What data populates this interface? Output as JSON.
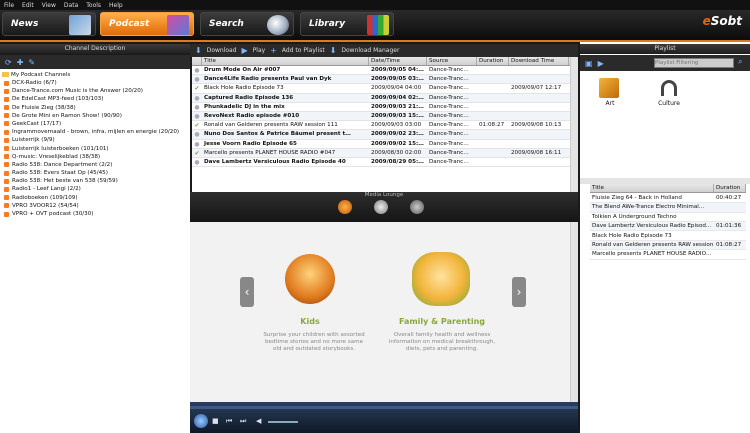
{
  "menu": [
    "File",
    "Edit",
    "View",
    "Data",
    "Tools",
    "Help"
  ],
  "nav": {
    "tabs": [
      {
        "label": "News",
        "active": false
      },
      {
        "label": "Podcast",
        "active": true
      },
      {
        "label": "Search",
        "active": false
      },
      {
        "label": "Library",
        "active": false
      }
    ],
    "logo_prefix": "e",
    "logo_rest": "Sobt"
  },
  "left_panel": {
    "title": "Channel Description",
    "root": "My Podcast Channels",
    "channels": [
      "DCX-Radio (6/7)",
      "Dance-Trance.com Music is the Answer (20/20)",
      "De EdelCast MP3-feed (103/103)",
      "De Fluisie Zieg (38/38)",
      "De Grote Mini en Ramon Show! (90/90)",
      "GeekCast (17/17)",
      "Ingrammovernaald - brown, infra, mijlen en energie (20/20)",
      "Luisterrijk (9/9)",
      "Luisterrijk luisterboeken (101/101)",
      "Q-music: Vreselijkeblad (38/38)",
      "Radio 538: Dance Department (2/2)",
      "Radio 538: Evers Staat Op (45/45)",
      "Radio 538: Het beste van 538 (59/59)",
      "Radio1 - Leef Langi (2/2)",
      "Radioboeken (109/109)",
      "VPRO 3VOOR12 (54/54)",
      "VPRO + OVT podcast (30/30)"
    ]
  },
  "episode_toolbar": {
    "download": "Download",
    "play": "Play",
    "add_to_playlist": "Add to Playlist",
    "download_manager": "Download Manager"
  },
  "episodes": {
    "columns": [
      "Title",
      "Date/Time",
      "Source",
      "Duration",
      "Download Time"
    ],
    "rows": [
      {
        "title": "Drum Mode On Air #007",
        "date": "2009/09/05 04:…",
        "source": "Dance-Tranc…",
        "duration": "",
        "dl": "",
        "bold": true,
        "check": false
      },
      {
        "title": "Dance4Life Radio presents Paul van Dyk",
        "date": "2009/09/05 03:…",
        "source": "Dance-Tranc…",
        "duration": "",
        "dl": "",
        "bold": true,
        "check": false
      },
      {
        "title": "Black Hole Radio Episode 73",
        "date": "2009/09/04 04:00",
        "source": "Dance-Tranc…",
        "duration": "",
        "dl": "2009/09/07 12:17",
        "bold": false,
        "check": true
      },
      {
        "title": "Captured Radio Episode 136",
        "date": "2009/09/04 02:…",
        "source": "Dance-Tranc…",
        "duration": "",
        "dl": "",
        "bold": true,
        "check": false
      },
      {
        "title": "Phunkadelic DJ in the mix",
        "date": "2009/09/03 21:…",
        "source": "Dance-Tranc…",
        "duration": "",
        "dl": "",
        "bold": true,
        "check": false
      },
      {
        "title": "RevoNext Radio episode #010",
        "date": "2009/09/03 15:…",
        "source": "Dance-Tranc…",
        "duration": "",
        "dl": "",
        "bold": true,
        "check": false
      },
      {
        "title": "Ronald van Gelderen presents RAW session 111",
        "date": "2009/09/03 03:00",
        "source": "Dance-Tranc…",
        "duration": "01:08:27",
        "dl": "2009/09/08 10:13",
        "bold": false,
        "check": true
      },
      {
        "title": "Nuno Dos Santos & Patrice Bäumel present t…",
        "date": "2009/09/02 23:…",
        "source": "Dance-Tranc…",
        "duration": "",
        "dl": "",
        "bold": true,
        "check": false
      },
      {
        "title": "Jesse Voorn Radio Episode 65",
        "date": "2009/09/02 15:…",
        "source": "Dance-Tranc…",
        "duration": "",
        "dl": "",
        "bold": true,
        "check": false
      },
      {
        "title": "Marcello presents PLANET HOUSE RADIO #047",
        "date": "2009/08/30 02:00",
        "source": "Dance-Tranc…",
        "duration": "",
        "dl": "2009/09/08 16:11",
        "bold": false,
        "check": true
      },
      {
        "title": "Dave Lambertz Versiculous Radio Episode 40",
        "date": "2009/08/29 05:…",
        "source": "Dance-Tranc…",
        "duration": "",
        "dl": "",
        "bold": true,
        "check": false
      }
    ]
  },
  "guide": {
    "title": "Media Lounge",
    "categories": [
      {
        "label": "Kids",
        "desc": "Surprise your children with assorted bedtime stories and no more same old and outdated storybooks."
      },
      {
        "label": "Family & Parenting",
        "desc": "Overall family health and wellness information on medical breakthrough, diets, pets and parenting."
      }
    ]
  },
  "right_panel": {
    "title": "Playlist",
    "filter_placeholder": "Playlist Filtering",
    "categories": [
      "Art",
      "Culture"
    ],
    "columns": [
      "Title",
      "Duration"
    ],
    "rows": [
      {
        "title": "Fluisie Zieg 64 - Back in Holland",
        "duration": "00:40:27"
      },
      {
        "title": "The Blend AWe-Trance Electro Minimal…",
        "duration": ""
      },
      {
        "title": "Tolkien A Underground Techno",
        "duration": ""
      },
      {
        "title": "Dave Lambertz Versiculous Radio Episod…",
        "duration": "01:01:36"
      },
      {
        "title": "Black Hole Radio Episode 73",
        "duration": ""
      },
      {
        "title": "Ronald van Gelderen presents RAW session…",
        "duration": "01:08:27"
      },
      {
        "title": "Marcello presents PLANET HOUSE RADIO…",
        "duration": ""
      }
    ]
  },
  "colors": {
    "accent": "#e06a08",
    "green": "#8aa83a"
  }
}
